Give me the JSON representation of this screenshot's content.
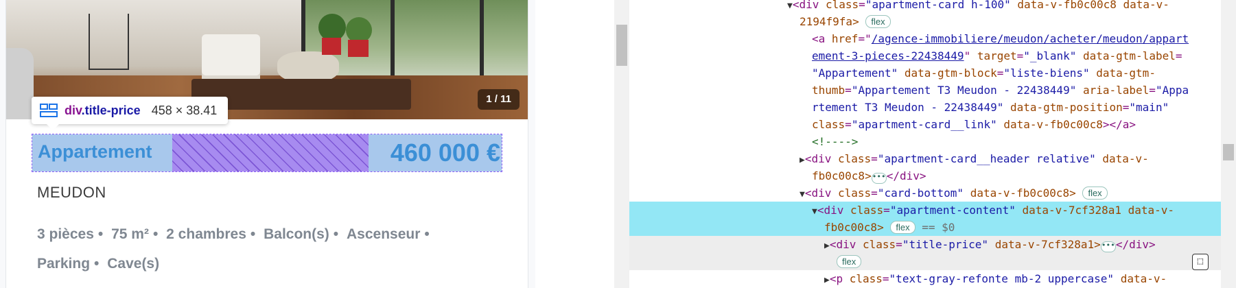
{
  "listing": {
    "photo_counter": "1 / 11",
    "title": "Appartement",
    "price": "460 000 €",
    "city": "MEUDON",
    "features": [
      "3 pièces",
      "75 m²",
      "2 chambres",
      "Balcon(s)",
      "Ascenseur",
      "Parking",
      "Cave(s)"
    ],
    "separator": "•"
  },
  "tooltip": {
    "tag": "div",
    "class_name": ".title-price",
    "dimensions": "458 × 38.41"
  },
  "devtools": {
    "line1": {
      "tag": "<div",
      "class_attr": "class",
      "class_val": "\"apartment-card h-100\"",
      "extra": "data-v-fb0c00c8 data-v-"
    },
    "line2": {
      "text": "2194f9fa>",
      "badge": "flex"
    },
    "line3": {
      "open": "<a",
      "attr": "href",
      "href": "/agence-immobiliere/meudon/acheter/meudon/appart"
    },
    "line4": {
      "href_cont": "ement-3-pieces-22438449",
      "attr2": "target",
      "val2": "\"_blank\"",
      "attr3": "data-gtm-label"
    },
    "line5": {
      "val3": "\"Appartement\"",
      "attr4": "data-gtm-block",
      "val4": "\"liste-biens\"",
      "attr5": "data-gtm-"
    },
    "line6": {
      "attr5b": "thumb",
      "val5": "\"Appartement T3 Meudon - 22438449\"",
      "attr6": "aria-label",
      "val6a": "\"Appa"
    },
    "line7": {
      "val6b": "rtement T3 Meudon - 22438449\"",
      "attr7": "data-gtm-position",
      "val7": "\"main\""
    },
    "line8": {
      "attr8": "class",
      "val8": "\"apartment-card__link\"",
      "attr9": "data-v-fb0c00c8",
      "close": "></a>"
    },
    "line9": {
      "comment": "<!---->"
    },
    "line10": {
      "tag": "<div",
      "attr": "class",
      "val": "\"apartment-card__header relative\"",
      "extra": "data-v-"
    },
    "line11": {
      "text": "fb0c00c8>",
      "close": "</div>"
    },
    "line12": {
      "tag": "<div",
      "attr": "class",
      "val": "\"card-bottom\"",
      "extra": "data-v-fb0c00c8>",
      "badge": "flex"
    },
    "line13": {
      "tag": "<div",
      "attr": "class",
      "val": "\"apartment-content\"",
      "extra": "data-v-7cf328a1 data-v-"
    },
    "line14": {
      "text": "fb0c00c8>",
      "badge": "flex",
      "eq": "== $0"
    },
    "line15": {
      "tag": "<div",
      "attr": "class",
      "val": "\"title-price\"",
      "extra": "data-v-7cf328a1>",
      "close": "</div>"
    },
    "line16": {
      "badge": "flex"
    },
    "line17": {
      "tag": "<p",
      "attr": "class",
      "val": "\"text-gray-refonte mb-2 uppercase\"",
      "extra": "data-v-"
    }
  }
}
